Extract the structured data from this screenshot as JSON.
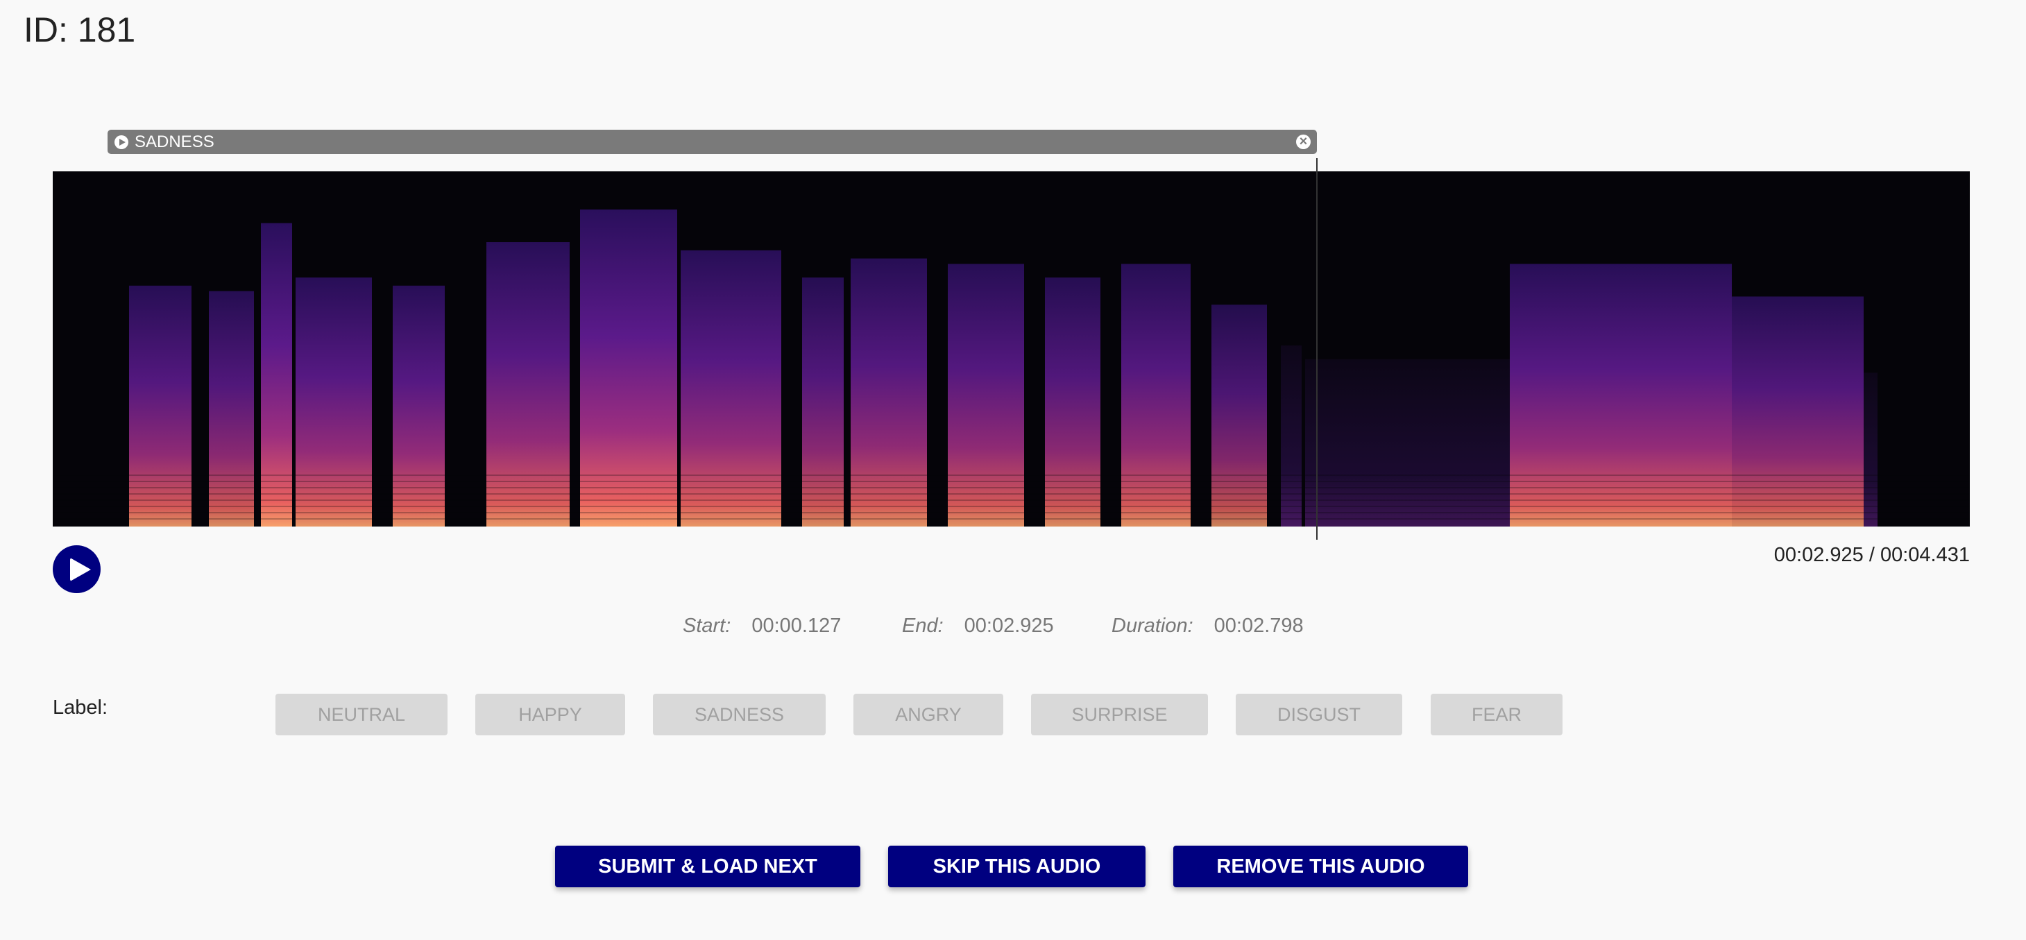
{
  "page": {
    "id_label": "ID: 181"
  },
  "region": {
    "label": "SADNESS",
    "play_icon": "play-circle-icon",
    "close_icon": "close-circle-icon"
  },
  "player": {
    "play_icon": "play-icon",
    "current_time": "00:02.925",
    "total_time": "00:04.431",
    "time_display": "00:02.925 / 00:04.431",
    "cursor_fraction": 0.66
  },
  "selection": {
    "start_label": "Start:",
    "start_value": "00:00.127",
    "end_label": "End:",
    "end_value": "00:02.925",
    "duration_label": "Duration:",
    "duration_value": "00:02.798"
  },
  "labels": {
    "title": "Label:",
    "options": [
      "NEUTRAL",
      "HAPPY",
      "SADNESS",
      "ANGRY",
      "SURPRISE",
      "DISGUST",
      "FEAR"
    ]
  },
  "actions": {
    "submit": "SUBMIT & LOAD NEXT",
    "skip": "SKIP THIS AUDIO",
    "remove": "REMOVE THIS AUDIO"
  },
  "colors": {
    "accent": "#000080",
    "region_bg": "#7a7a7a",
    "label_btn_bg": "#d9d9d9",
    "label_btn_text": "#a0a0a0",
    "page_bg": "#f9f9f9"
  }
}
